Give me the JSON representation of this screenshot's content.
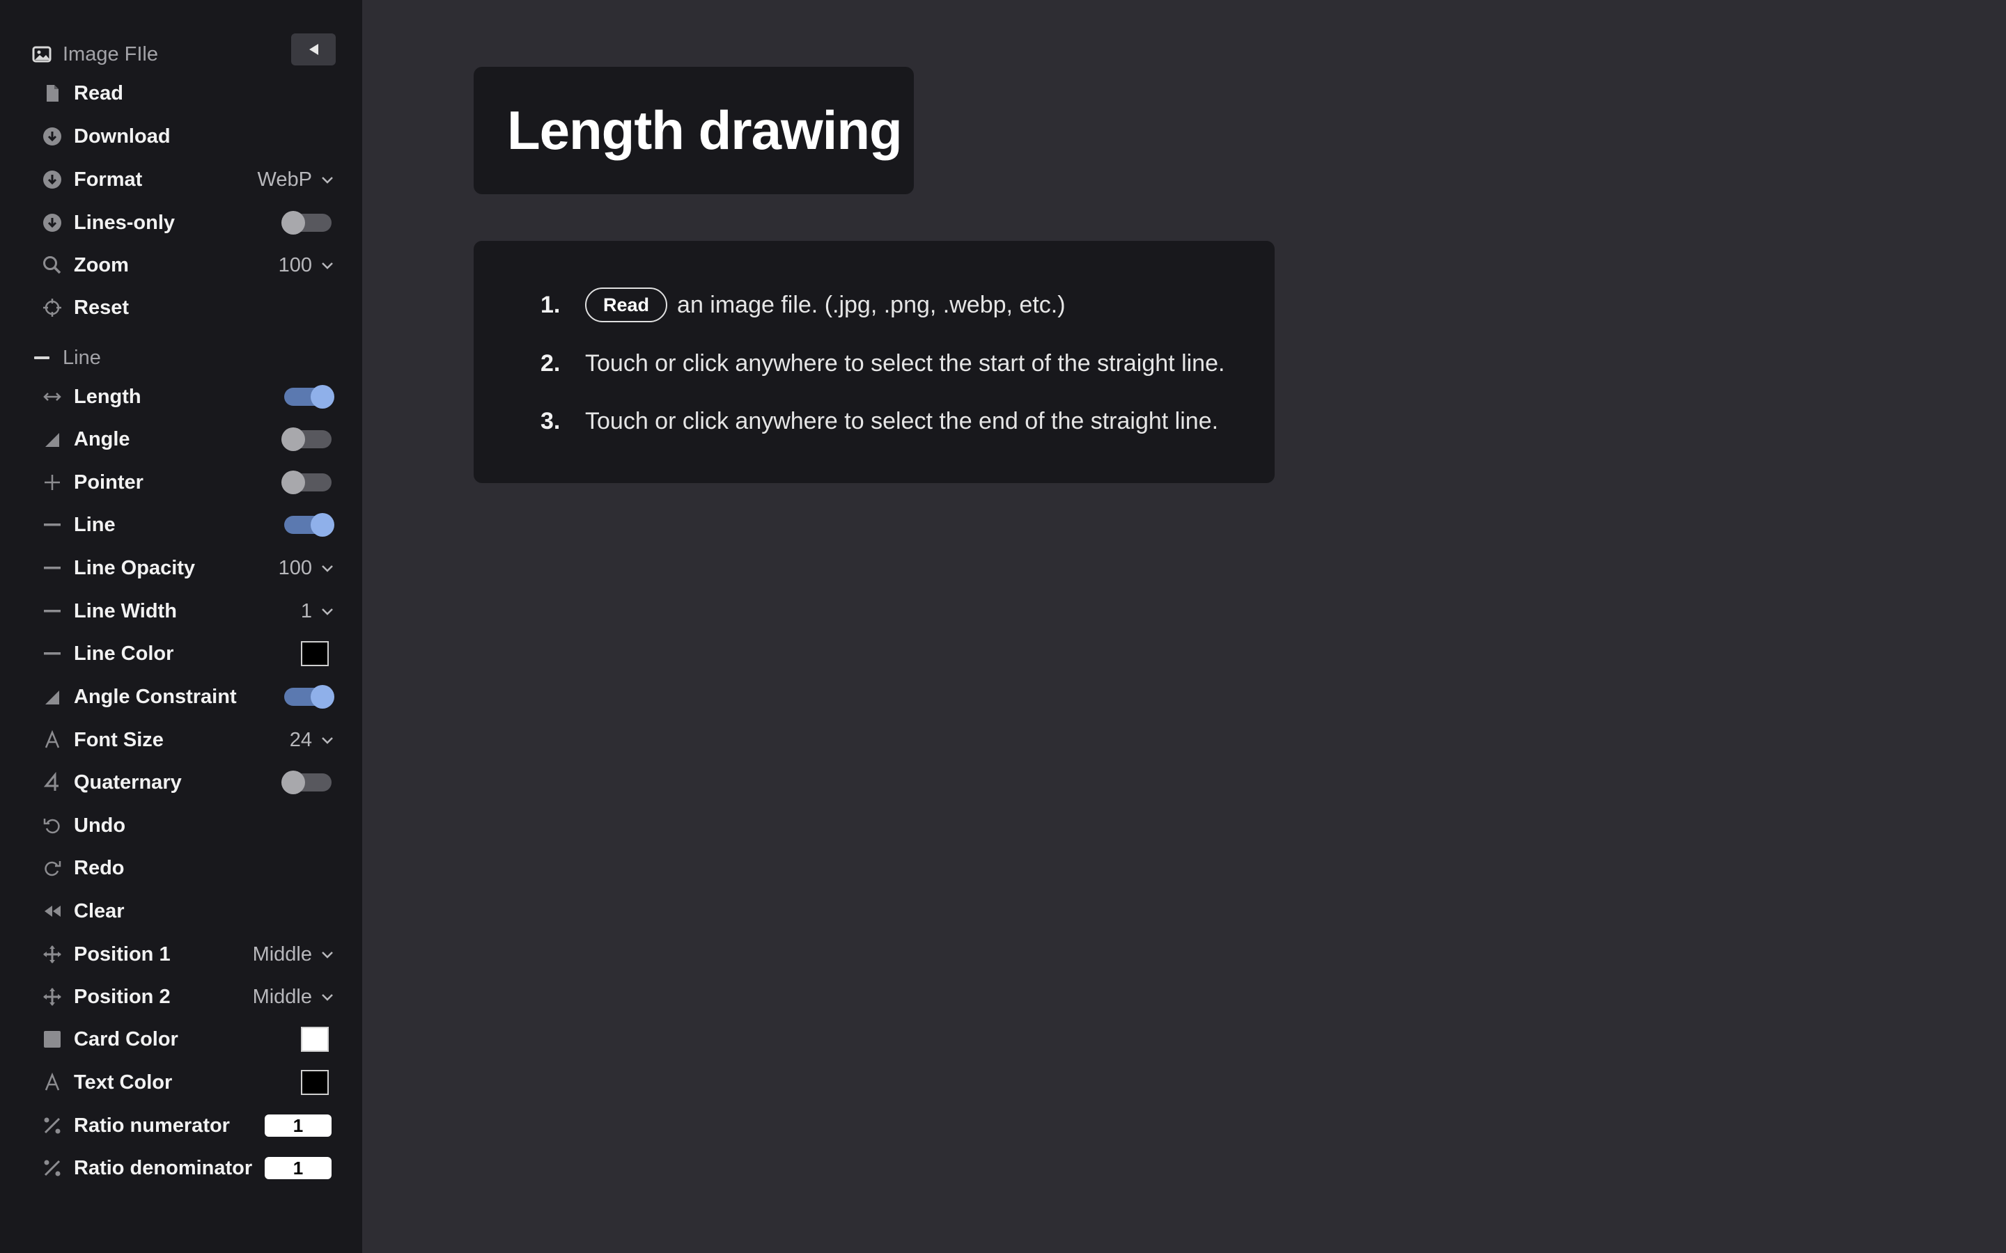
{
  "sidebar": {
    "image_file_header": "Image FIle",
    "line_header": "Line",
    "read": "Read",
    "download": "Download",
    "format": {
      "label": "Format",
      "value": "WebP"
    },
    "lines_only": {
      "label": "Lines-only",
      "on": false
    },
    "zoom": {
      "label": "Zoom",
      "value": "100"
    },
    "reset": "Reset",
    "length": {
      "label": "Length",
      "on": true
    },
    "angle": {
      "label": "Angle",
      "on": false
    },
    "pointer": {
      "label": "Pointer",
      "on": false
    },
    "line": {
      "label": "Line",
      "on": true
    },
    "line_opacity": {
      "label": "Line Opacity",
      "value": "100"
    },
    "line_width": {
      "label": "Line Width",
      "value": "1"
    },
    "line_color": {
      "label": "Line Color",
      "color": "#000000"
    },
    "angle_constraint": {
      "label": "Angle Constraint",
      "on": true
    },
    "font_size": {
      "label": "Font Size",
      "value": "24"
    },
    "quaternary": {
      "label": "Quaternary",
      "on": false
    },
    "undo": "Undo",
    "redo": "Redo",
    "clear": "Clear",
    "position1": {
      "label": "Position 1",
      "value": "Middle"
    },
    "position2": {
      "label": "Position 2",
      "value": "Middle"
    },
    "card_color": {
      "label": "Card Color",
      "color": "#ffffff"
    },
    "text_color": {
      "label": "Text Color",
      "color": "#000000"
    },
    "ratio_numerator": {
      "label": "Ratio numerator",
      "value": "1"
    },
    "ratio_denominator": {
      "label": "Ratio denominator",
      "value": "1"
    }
  },
  "main": {
    "title": "Length drawing",
    "steps": [
      {
        "num": "1.",
        "button": "Read",
        "text": "an image file. (.jpg, .png, .webp, etc.)"
      },
      {
        "num": "2.",
        "text": "Touch or click anywhere to select the start of the straight line."
      },
      {
        "num": "3.",
        "text": "Touch or click anywhere to select the end of the straight line."
      }
    ]
  },
  "colors": {
    "sidebar_bg": "#18181c",
    "main_bg": "#2e2d33",
    "card_bg": "#18181c",
    "toggle_on": "#5b79b0",
    "toggle_off": "#58585e"
  }
}
